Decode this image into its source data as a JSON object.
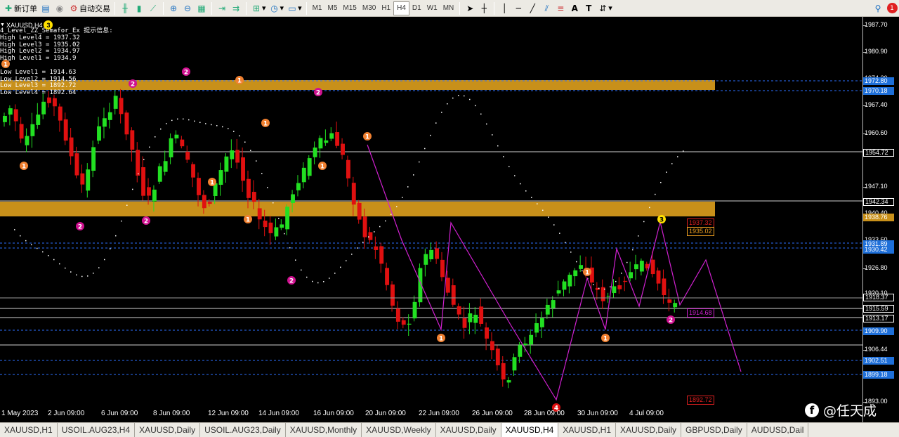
{
  "toolbar": {
    "new_order_label": "新订单",
    "auto_trade_label": "自动交易",
    "timeframes": [
      "M1",
      "M5",
      "M15",
      "M30",
      "H1",
      "H4",
      "D1",
      "W1",
      "MN"
    ],
    "notification_count": "1"
  },
  "chart": {
    "symbol_label": "XAUUSD,H4",
    "indicator_lines": [
      "4_Level_ZZ_Semafor_Ex 提示信息:",
      "High Level4 = 1937.32",
      "High Level3 = 1935.02",
      "High Level2 = 1934.97",
      "High Level1 = 1934.9",
      "",
      "Low Level1 = 1914.63",
      "Low Level2 = 1914.56",
      "Low Level3 = 1892.72",
      "Low Level4 = 1892.64"
    ],
    "marker_top_left": "3",
    "chart_labels": [
      {
        "text": "1937.32",
        "color": "#e02020"
      },
      {
        "text": "1935.02",
        "color": "#f0a020"
      },
      {
        "text": "1914.68",
        "color": "#d020d0"
      },
      {
        "text": "1892.72",
        "color": "#e02020"
      }
    ]
  },
  "price_axis": {
    "labels": [
      "1987.70",
      "1980.90",
      "1974.20",
      "1967.40",
      "1960.60",
      "1947.10",
      "1940.40",
      "1933.60",
      "1926.80",
      "1920.10",
      "1906.44",
      "1893.00"
    ],
    "boxes": [
      {
        "text": "1972.80",
        "bg": "#1e6fd9"
      },
      {
        "text": "1970.18",
        "bg": "#1e6fd9"
      },
      {
        "text": "1954.72",
        "bg": "#000000"
      },
      {
        "text": "1942.34",
        "bg": "#000000"
      },
      {
        "text": "1938.76",
        "bg": "#c8901a"
      },
      {
        "text": "1931.89",
        "bg": "#1e6fd9"
      },
      {
        "text": "1930.42",
        "bg": "#1e6fd9"
      },
      {
        "text": "1918.37",
        "bg": "#000000"
      },
      {
        "text": "1915.59",
        "bg": "#000000"
      },
      {
        "text": "1913.17",
        "bg": "#000000"
      },
      {
        "text": "1909.90",
        "bg": "#1e6fd9"
      },
      {
        "text": "1902.51",
        "bg": "#1e6fd9"
      },
      {
        "text": "1899.18",
        "bg": "#1e6fd9"
      }
    ]
  },
  "time_axis": [
    "1 May 2023",
    "2 Jun 09:00",
    "6 Jun 09:00",
    "8 Jun 09:00",
    "12 Jun 09:00",
    "14 Jun 09:00",
    "16 Jun 09:00",
    "20 Jun 09:00",
    "22 Jun 09:00",
    "26 Jun 09:00",
    "28 Jun 09:00",
    "30 Jun 09:00",
    "4 Jul 09:00"
  ],
  "tabs": [
    "XAUUSD,H1",
    "USOIL.AUG23,H4",
    "XAUUSD,Daily",
    "USOIL.AUG23,Daily",
    "XAUUSD,Monthly",
    "XAUUSD,Weekly",
    "XAUUSD,Daily",
    "XAUUSD,H4",
    "XAUUSD,H1",
    "XAUUSD,Daily",
    "GBPUSD,Daily",
    "AUDUSD,Dail"
  ],
  "active_tab": "XAUUSD,H4",
  "watermark": "@任天成",
  "colors": {
    "bull": "#22e022",
    "bear": "#e01010",
    "zone": "#c8901a",
    "zigzag": "#d020d0",
    "level_blue": "#2b6fff"
  }
}
